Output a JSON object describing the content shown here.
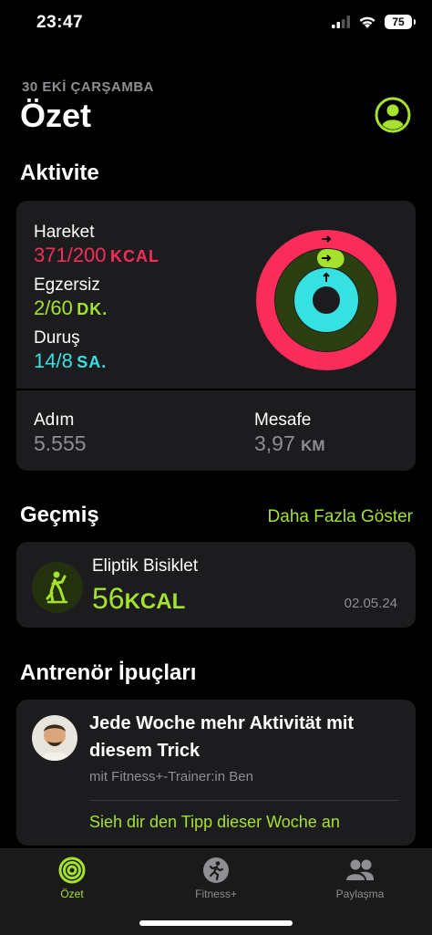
{
  "status_bar": {
    "time": "23:47",
    "battery": "75"
  },
  "header": {
    "date": "30 EKİ ÇARŞAMBA",
    "title": "Özet"
  },
  "activity": {
    "section_title": "Aktivite",
    "move": {
      "label": "Hareket",
      "value": "371/200",
      "unit": "KCAL",
      "color": "#fa2d5a",
      "progress": 1.855
    },
    "exercise": {
      "label": "Egzersiz",
      "value": "2/60",
      "unit": "DK.",
      "color": "#a4e22e",
      "progress": 0.033
    },
    "stand": {
      "label": "Duruş",
      "value": "14/8",
      "unit": "SA.",
      "color": "#36e1e1",
      "progress": 1.75
    },
    "steps": {
      "label": "Adım",
      "value": "5.555"
    },
    "distance": {
      "label": "Mesafe",
      "value": "3,97",
      "unit": "KM"
    }
  },
  "history": {
    "section_title": "Geçmiş",
    "show_more": "Daha Fazla Göster",
    "workout": {
      "name": "Eliptik Bisiklet",
      "value": "56",
      "unit": "KCAL",
      "date": "02.05.24"
    }
  },
  "tips": {
    "section_title": "Antrenör İpuçları",
    "title": "Jede Woche mehr Aktivität mit diesem Trick",
    "subtitle": "mit Fitness+-Trainer:in Ben",
    "link": "Sieh dir den Tipp dieser Woche an"
  },
  "tab_bar": {
    "tabs": [
      {
        "label": "Özet",
        "icon": "summary-rings-icon",
        "active": true
      },
      {
        "label": "Fitness+",
        "icon": "fitness-plus-icon",
        "active": false
      },
      {
        "label": "Paylaşma",
        "icon": "sharing-people-icon",
        "active": false
      }
    ]
  },
  "colors": {
    "accent": "#a4e22e",
    "move": "#fa2d5a",
    "exercise": "#a4e22e",
    "stand": "#36e1e1",
    "card": "#1c1c1e"
  }
}
